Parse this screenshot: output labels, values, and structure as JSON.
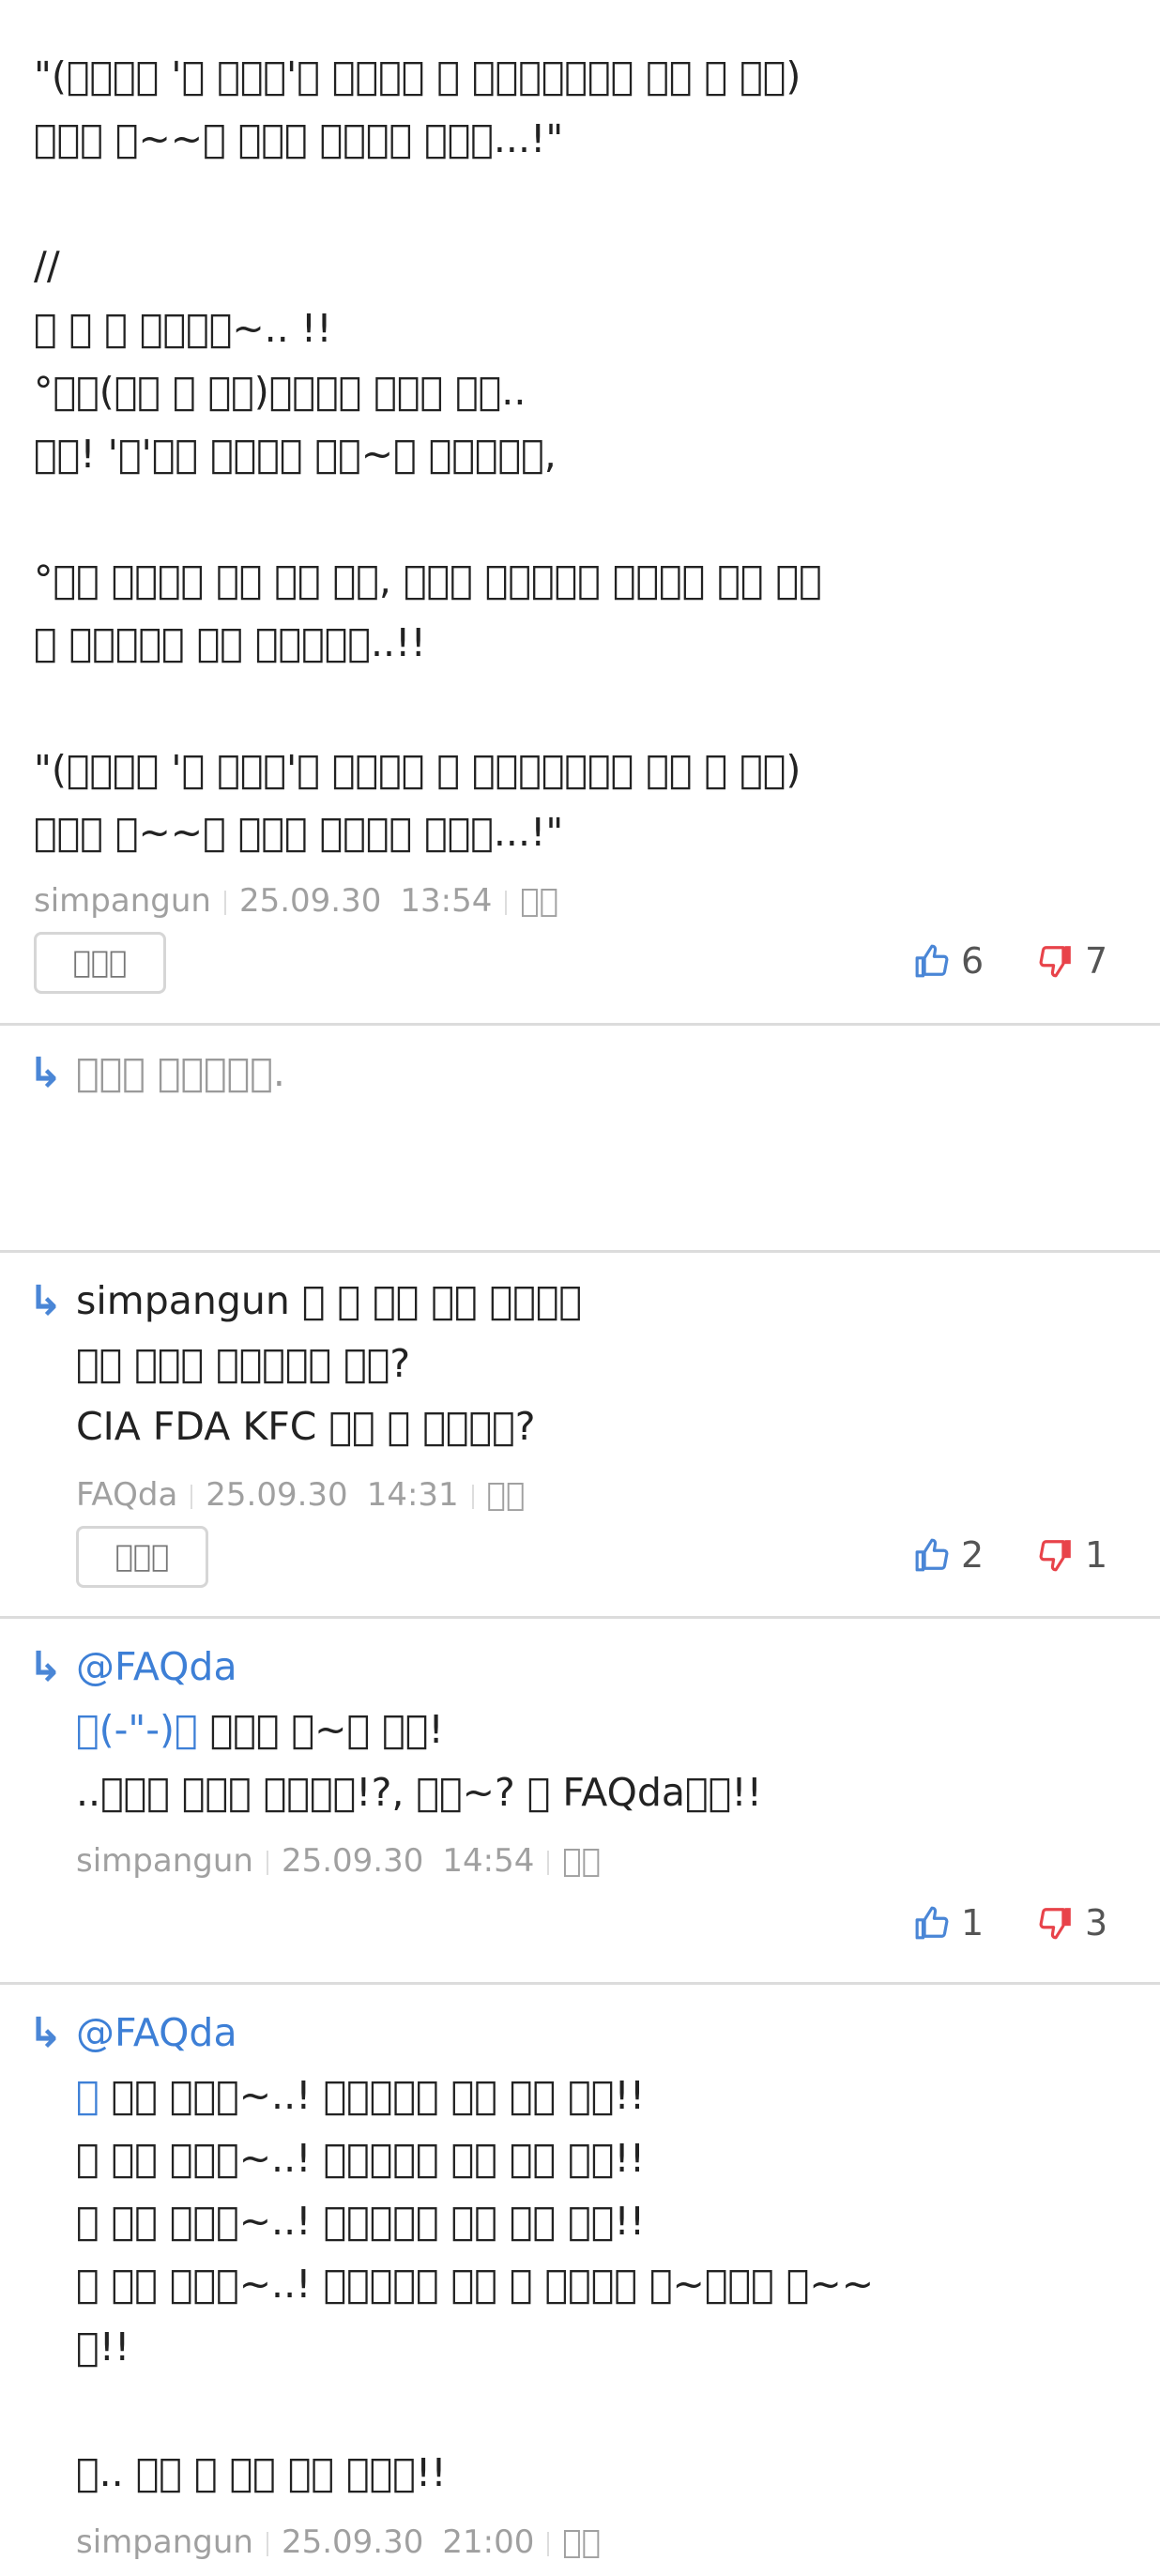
{
  "comment1": {
    "lines": [
      "\"(󰀀󰀀󰀀󰀀 '󰀀 󰀀󰀀󰀀'󰀀 󰀀󰀀󰀀󰀀 󰀀 󰀀󰀀󰀀󰀀󰀀󰀀󰀀 󰀀󰀀 󰀀 󰀀󰀀)",
      "󰀀󰀀󰀀 󰀀~~󰀀 󰀀󰀀󰀀 󰀀󰀀󰀀󰀀 󰀀󰀀󰀀...!\"",
      "//",
      "󰀀 󰀀 󰀀 󰀀󰀀󰀀󰀀~.. !!",
      "°󰀀󰀀(󰀀󰀀 󰀀 󰀀󰀀)󰀀󰀀󰀀󰀀 󰀀󰀀󰀀 󰀀󰀀..",
      "󰀀󰀀! '󰀀'󰀀󰀀 󰀀󰀀󰀀󰀀 󰀀󰀀~󰀀 󰀀󰀀󰀀󰀀󰀀,",
      "°󰀀󰀀 󰀀󰀀󰀀󰀀 󰀀󰀀 󰀀󰀀 󰀀󰀀, 󰀀󰀀󰀀 󰀀󰀀󰀀󰀀󰀀 󰀀󰀀󰀀󰀀 󰀀󰀀 󰀀󰀀",
      "󰀀 󰀀󰀀󰀀󰀀󰀀 󰀀󰀀 󰀀󰀀󰀀󰀀󰀀..!!",
      "\"(󰀀󰀀󰀀󰀀 '󰀀 󰀀󰀀󰀀'󰀀 󰀀󰀀󰀀󰀀 󰀀 󰀀󰀀󰀀󰀀󰀀󰀀󰀀 󰀀󰀀 󰀀 󰀀󰀀)",
      "󰀀󰀀󰀀 󰀀~~󰀀 󰀀󰀀󰀀 󰀀󰀀󰀀󰀀 󰀀󰀀󰀀...!\""
    ],
    "author": "simpangun",
    "date": "25.09.30",
    "time": "13:54",
    "extra": "󰀀󰀀",
    "reply_label": "󰀀󰀀󰀀",
    "up": "6",
    "down": "7"
  },
  "reply1": {
    "text": "󰀀󰀀󰀀 󰀀󰀀󰀀󰀀󰀀."
  },
  "reply2": {
    "lines": [
      "simpangun 󰀀 󰀀 󰀀󰀀 󰀀󰀀 󰀀󰀀󰀀󰀀",
      "󰀀󰀀 󰀀󰀀󰀀 󰀀󰀀󰀀󰀀󰀀 󰀀󰀀?",
      "CIA FDA KFC 󰀀󰀀 󰀀 󰀀󰀀󰀀󰀀?"
    ],
    "author": "FAQda",
    "date": "25.09.30",
    "time": "14:31",
    "extra": "󰀀󰀀",
    "reply_label": "󰀀󰀀󰀀",
    "up": "2",
    "down": "1"
  },
  "reply3": {
    "mention": "@FAQda",
    "emote": "󰀀(-\"-)󰀀",
    "line1_rest": " 󰀀󰀀󰀀 󰀀~󰀀 󰀀󰀀!",
    "line2": "..󰀀󰀀󰀀 󰀀󰀀󰀀 󰀀󰀀󰀀󰀀!?, 󰀀󰀀~? 󰀀 FAQda󰀀󰀀!!",
    "author": "simpangun",
    "date": "25.09.30",
    "time": "14:54",
    "extra": "󰀀󰀀",
    "up": "1",
    "down": "3"
  },
  "reply4": {
    "mention": "@FAQda",
    "emote": "󰀀",
    "line1_rest": " 󰀀󰀀 󰀀󰀀󰀀~..! 󰀀󰀀󰀀󰀀󰀀 󰀀󰀀 󰀀󰀀 󰀀󰀀!!",
    "lines": [
      "󰀀 󰀀󰀀 󰀀󰀀󰀀~..! 󰀀󰀀󰀀󰀀󰀀 󰀀󰀀 󰀀󰀀 󰀀󰀀!!",
      "󰀀 󰀀󰀀 󰀀󰀀󰀀~..! 󰀀󰀀󰀀󰀀󰀀 󰀀󰀀 󰀀󰀀 󰀀󰀀!!",
      "󰀀 󰀀󰀀 󰀀󰀀󰀀~..! 󰀀󰀀󰀀󰀀󰀀 󰀀󰀀 󰀀 󰀀󰀀󰀀󰀀 󰀀~󰀀󰀀󰀀 󰀀~~",
      "󰀀!!",
      "󰀀.. 󰀀󰀀 󰀀 󰀀󰀀 󰀀󰀀 󰀀󰀀󰀀!!"
    ],
    "author": "simpangun",
    "date": "25.09.30",
    "time": "21:00",
    "extra": "󰀀󰀀"
  },
  "icons": {
    "like": "thumbs-up-icon",
    "dislike": "thumbs-down-icon",
    "reply_arrow": "reply-arrow-icon"
  },
  "colors": {
    "like": "#4a86d6",
    "dislike": "#e8434a",
    "mention": "#3d7fd6",
    "meta": "#a0a0a0",
    "divider": "#dcdcdc"
  }
}
